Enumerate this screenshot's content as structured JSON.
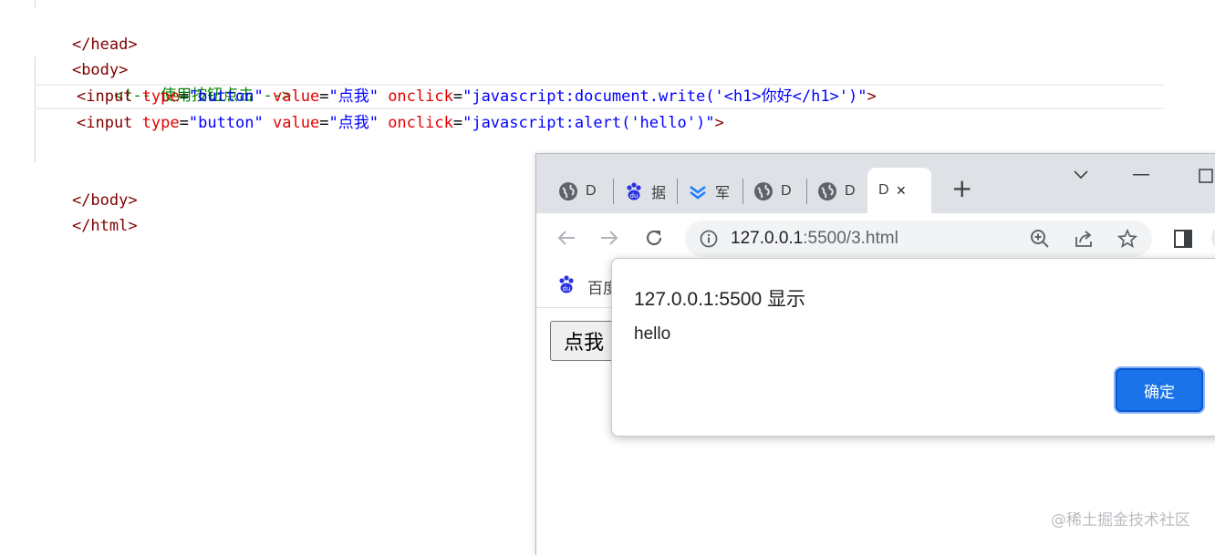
{
  "editor": {
    "lines": {
      "head_close": "</head>",
      "body_open": "<body>",
      "comment": "<!-- 使用按钮点击 -->",
      "input1": {
        "open": "<input",
        "attr_type": "type",
        "val_type": "\"button\"",
        "attr_value": "value",
        "val_value": "\"点我\"",
        "attr_onclick": "onclick",
        "val_onclick": "\"javascript:document.write('<h1>你好</h1>')\"",
        "close": ">"
      },
      "input2": {
        "open": "<input",
        "attr_type": "type",
        "val_type": "\"button\"",
        "attr_value": "value",
        "val_value": "\"点我\"",
        "attr_onclick": "onclick",
        "val_onclick": "\"javascript:alert('hello')\"",
        "close": ">"
      },
      "body_close": "</body>",
      "html_close": "</html>"
    },
    "eq": "="
  },
  "browser": {
    "tabs": [
      {
        "icon": "globe-icon",
        "label": "D"
      },
      {
        "icon": "baidu-paw-icon",
        "label": "据"
      },
      {
        "icon": "chevrons-icon",
        "label": "军"
      },
      {
        "icon": "globe-icon",
        "label": "D"
      },
      {
        "icon": "globe-icon",
        "label": "D"
      }
    ],
    "active_tab": {
      "label": "D",
      "close": "×"
    },
    "new_tab": "+",
    "url_host": "127.0.0.1",
    "url_rest": ":5500/3.html",
    "bookmark_label": "百度",
    "page_button": "点我"
  },
  "dialog": {
    "title": "127.0.0.1:5500 显示",
    "message": "hello",
    "ok_label": "确定"
  },
  "watermark": "@稀土掘金技术社区",
  "colors": {
    "accent": "#1a73e8",
    "tag": "#800000",
    "attr": "#e50000",
    "value": "#0000ff",
    "comment": "#008000"
  }
}
